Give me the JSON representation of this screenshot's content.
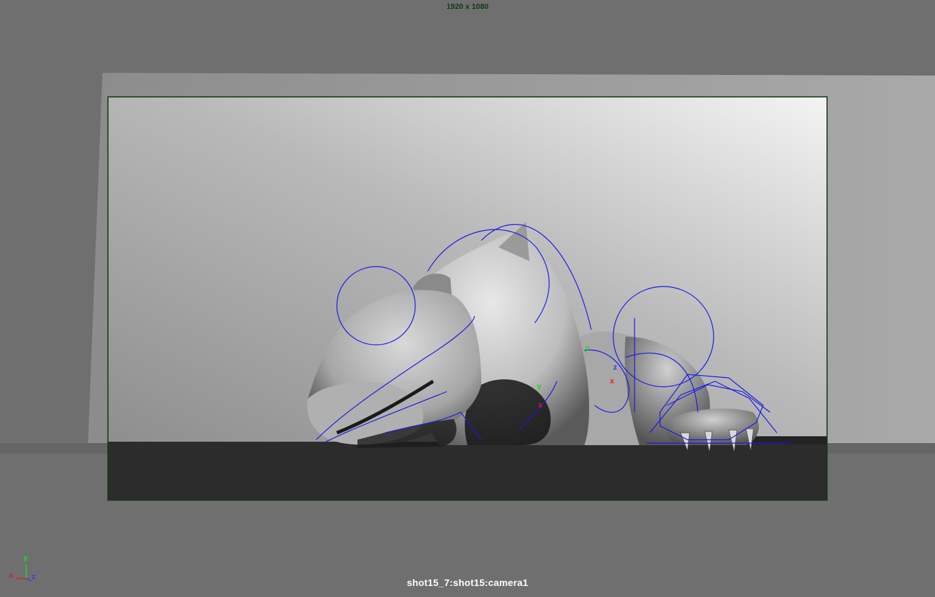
{
  "viewport": {
    "resolution_label": "1920 x 1080",
    "camera_label": "shot15_7:shot15:camera1",
    "background_color": "#6f6f6f",
    "gate_color": "#0f3b14",
    "rig_curve_color": "#1a1ae6"
  },
  "axis_indicator": {
    "x_label": "x",
    "y_label": "y",
    "z_label": "z",
    "x_color": "#e21d1d",
    "y_color": "#1ddc1d",
    "z_color": "#2f3fe8"
  },
  "manipulators": [
    {
      "y_label": "y",
      "x_label": "x"
    },
    {
      "y_label": "y",
      "x_label": "x",
      "z_label": "z"
    }
  ]
}
